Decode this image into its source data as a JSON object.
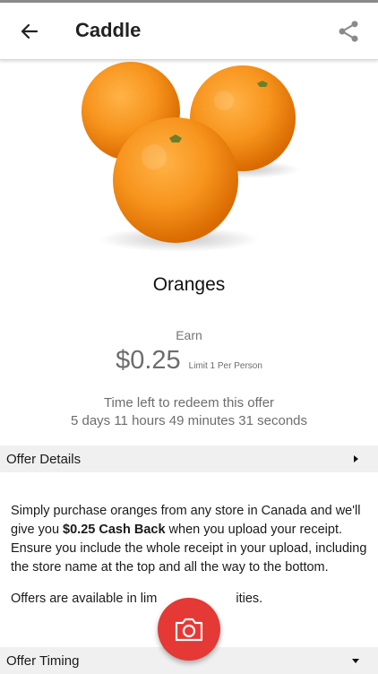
{
  "appbar": {
    "title": "Caddle",
    "back_icon": "arrow-left-icon",
    "share_icon": "share-icon"
  },
  "product": {
    "name": "Oranges",
    "image": "oranges-photo"
  },
  "reward": {
    "earn_label": "Earn",
    "amount": "$0.25",
    "limit": "Limit 1 Per Person"
  },
  "timer": {
    "label": "Time left to redeem this offer",
    "countdown": "5 days 11 hours 49 minutes 31 seconds"
  },
  "sections": {
    "offer_details": "Offer Details",
    "offer_timing": "Offer Timing"
  },
  "details": {
    "p1_a": "Simply purchase oranges from any store in Canada and we'll give you ",
    "p1_bold": "$0.25 Cash Back",
    "p1_b": " when you upload your receipt. Ensure you include the whole receipt in your upload, including the store name at the top and all the way to the bottom.",
    "p2_a": "Offers are available in lim",
    "p2_b": "ities."
  },
  "fab": {
    "icon": "camera-icon"
  },
  "colors": {
    "accent": "#e53935",
    "section_bg": "#f0f0f0",
    "muted_text": "#6d6d6d"
  }
}
